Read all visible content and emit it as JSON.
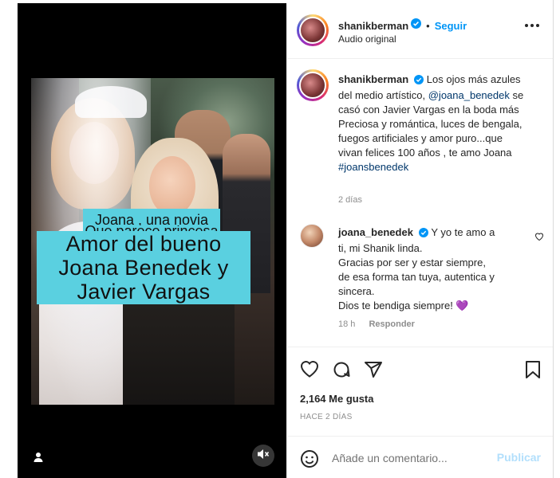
{
  "media": {
    "caption_small_line1": "Joana , una novia",
    "caption_small_line2": "Que parece princesa",
    "caption_big_line1": "Amor del bueno",
    "caption_big_line2": "Joana Benedek y",
    "caption_big_line3": "Javier Vargas",
    "icons": {
      "user": "user-tag-icon",
      "mute": "speaker-muted-icon"
    }
  },
  "header": {
    "username": "shanikberman",
    "dot": "•",
    "follow_label": "Seguir",
    "audio": "Audio original",
    "more_icon": "more-options-icon"
  },
  "comments": [
    {
      "username": "shanikberman",
      "text_before_mention": "Los ojos más azules del medio artístico,",
      "mention": "@joana_benedek",
      "text_after_mention": "se casó con Javier Vargas en la boda más Preciosa y romántica, luces de bengala, fuegos artificiales y amor puro...que vivan felices 100 años , te amo Joana",
      "hashtag": "#joansbenedek",
      "time": "2 días"
    },
    {
      "username": "joana_benedek",
      "text_line1": "Y yo te amo a ti, mi Shanik linda.",
      "text_line2": "Gracias por ser y estar siempre, de esa forma tan tuya, autentica y sincera.",
      "text_line3": "Dios te bendiga siempre! 💜",
      "time": "18 h",
      "reply_label": "Responder"
    }
  ],
  "actions": {
    "likes": "2,164 Me gusta",
    "date": "HACE 2 DÍAS",
    "icons": [
      "heart-icon",
      "comment-icon",
      "share-icon",
      "bookmark-icon"
    ]
  },
  "add_comment": {
    "placeholder": "Añade un comentario...",
    "publish_label": "Publicar",
    "emoji_icon": "emoji-icon"
  },
  "colors": {
    "accent": "#0095f6",
    "caption_bg": "#5ad0e0",
    "publish_disabled": "#b2dffc",
    "mention": "#00376b"
  }
}
